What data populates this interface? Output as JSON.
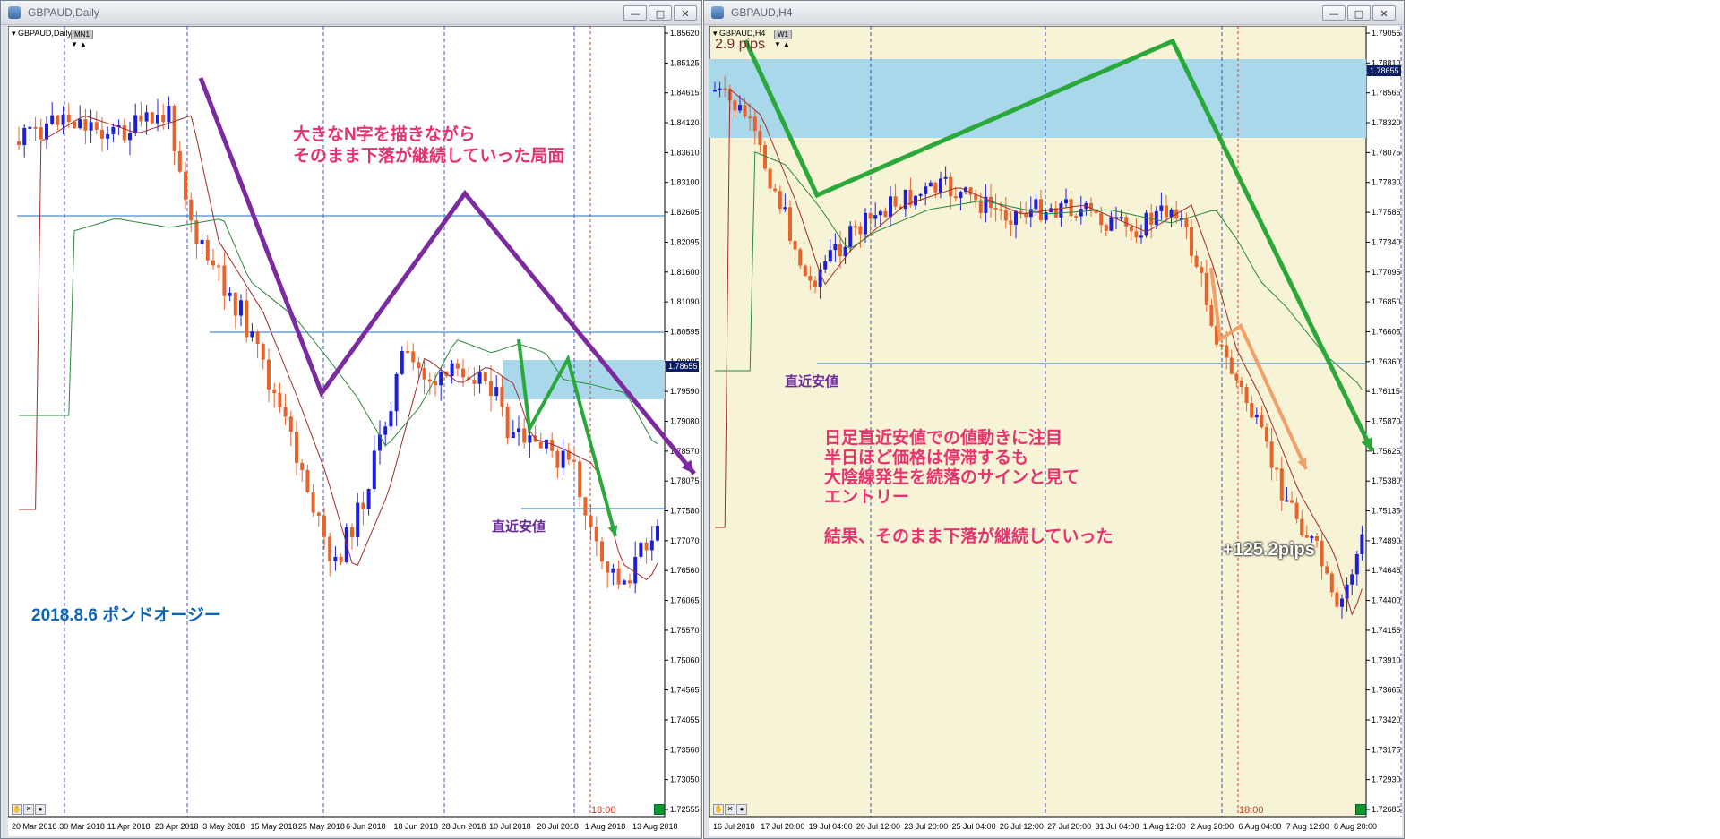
{
  "left_window": {
    "title": "GBPAUD,Daily",
    "symbol_label": "GBPAUD,Daily",
    "tf_badge": "MN1",
    "price_axis": [
      "1.85620",
      "1.85125",
      "1.84615",
      "1.84120",
      "1.83610",
      "1.83100",
      "1.82605",
      "1.82095",
      "1.81600",
      "1.81090",
      "1.80595",
      "1.80085",
      "1.79590",
      "1.79080",
      "1.78570",
      "1.78075",
      "1.77580",
      "1.77070",
      "1.76560",
      "1.76065",
      "1.75570",
      "1.75060",
      "1.74565",
      "1.74055",
      "1.73560",
      "1.73050",
      "1.72555"
    ],
    "current_price": "1.78655",
    "date_axis": [
      "20 Mar 2018",
      "30 Mar 2018",
      "11 Apr 2018",
      "23 Apr 2018",
      "3 May 2018",
      "15 May 2018",
      "25 May 2018",
      "6 Jun 2018",
      "18 Jun 2018",
      "28 Jun 2018",
      "10 Jul 2018",
      "20 Jul 2018",
      "1 Aug 2018",
      "13 Aug 2018"
    ],
    "time_label": "18:00",
    "annotation_main": "大きなN字を描きながら\nそのまま下落が継続していった局面",
    "annotation_low": "直近安値",
    "annotation_date": "2018.8.6 ポンドオージー",
    "colors": {
      "bull": "#1d1ed8",
      "bear": "#e8632b",
      "pattern": "#7b2aa0",
      "arrow": "#2aa83a",
      "zone": "#a9d8ea",
      "annotation": "#e8326e",
      "date_text": "#0b65b8"
    }
  },
  "right_window": {
    "title": "GBPAUD,H4",
    "symbol_label": "GBPAUD,H4",
    "tf_badge": "W1",
    "spread": "2.9 pips",
    "price_axis": [
      "1.79055",
      "1.78810",
      "1.78565",
      "1.78320",
      "1.78075",
      "1.77830",
      "1.77585",
      "1.77340",
      "1.77095",
      "1.76850",
      "1.76605",
      "1.76360",
      "1.76115",
      "1.75870",
      "1.75625",
      "1.75380",
      "1.75135",
      "1.74890",
      "1.74645",
      "1.74400",
      "1.74155",
      "1.73910",
      "1.73665",
      "1.73420",
      "1.73175",
      "1.72930",
      "1.72685"
    ],
    "current_price": "1.78655",
    "date_axis": [
      "16 Jul 2018",
      "17 Jul 20:00",
      "19 Jul 04:00",
      "20 Jul 12:00",
      "23 Jul 20:00",
      "25 Jul 04:00",
      "26 Jul 12:00",
      "27 Jul 20:00",
      "31 Jul 04:00",
      "1 Aug 12:00",
      "2 Aug 20:00",
      "6 Aug 04:00",
      "7 Aug 12:00",
      "8 Aug 20:00"
    ],
    "time_label": "18:00",
    "annotation_low": "直近安値",
    "annotation_main": "日足直近安値での値動きに注目\n半日ほど価格は停滞するも\n大陰線発生を続落のサインと見て\nエントリー\n\n結果、そのまま下落が継続していった",
    "result": "+125.2pips",
    "colors": {
      "bg": "#f7f3d6",
      "bull": "#1d1ed8",
      "bear": "#e8632b",
      "arrow": "#2aa83a",
      "entry_arrow": "#f2a06a",
      "zone": "#a9d8ea",
      "annotation": "#e8326e"
    }
  }
}
